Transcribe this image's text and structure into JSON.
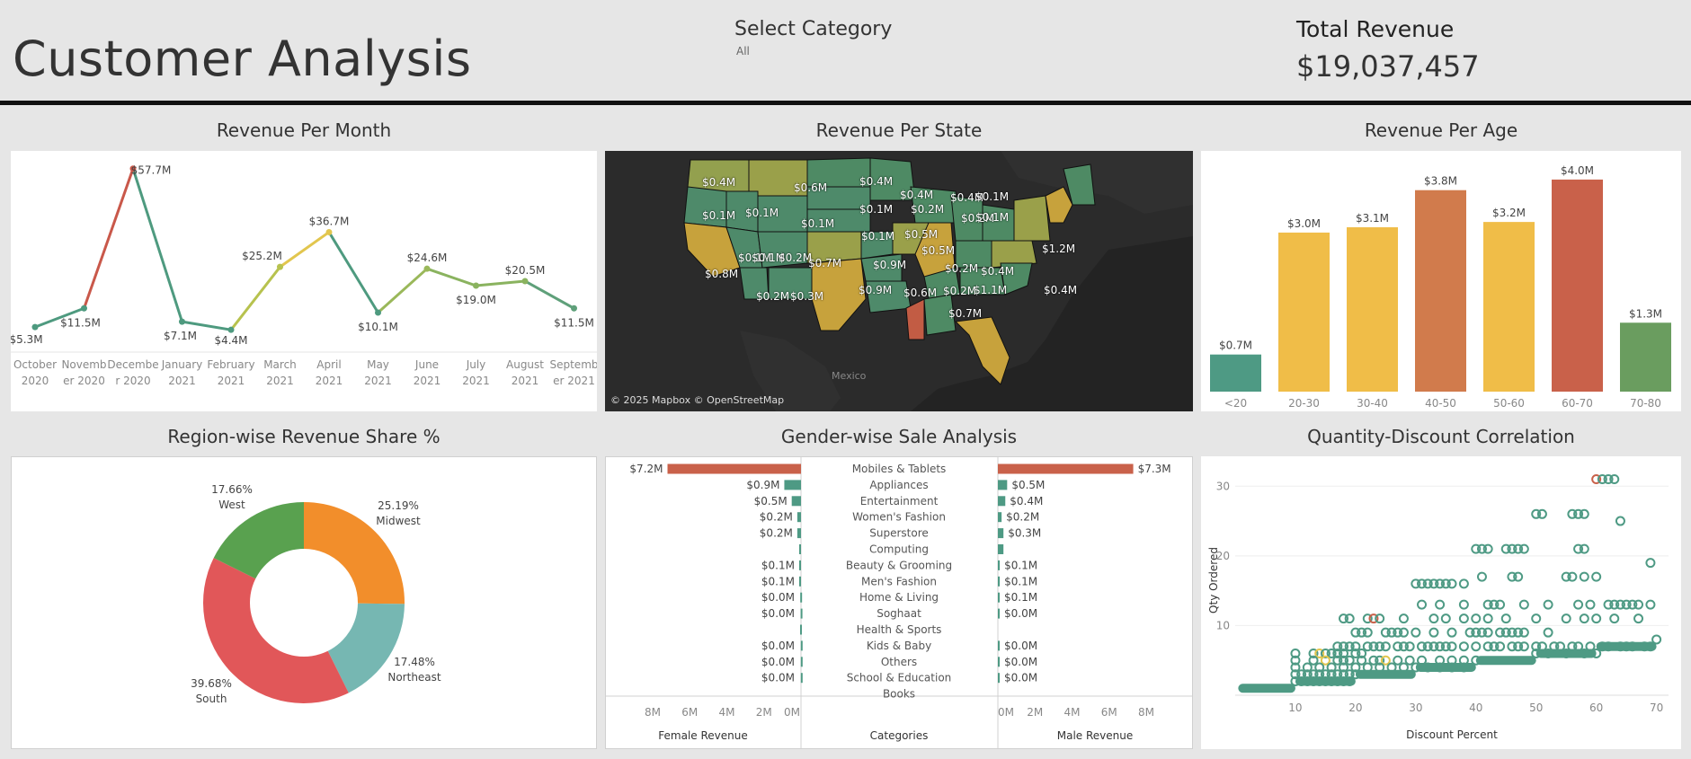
{
  "header": {
    "title": "Customer Analysis",
    "category_label": "Select Category",
    "category_value": "All",
    "revenue_label": "Total Revenue",
    "revenue_value": "$19,037,457"
  },
  "panels": {
    "month": "Revenue Per Month",
    "state": "Revenue Per State",
    "age": "Revenue Per Age",
    "region": "Region-wise Revenue Share %",
    "gender": "Gender-wise Sale Analysis",
    "scatter": "Quantity-Discount Correlation"
  },
  "map": {
    "copyright": "© 2025 Mapbox © OpenStreetMap",
    "country_label": "Mexico"
  },
  "chart_data": [
    {
      "id": "month",
      "type": "line",
      "title": "Revenue Per Month",
      "categories": [
        [
          "October",
          "2020"
        ],
        [
          "Novemb",
          "er 2020"
        ],
        [
          "Decembe",
          "r 2020"
        ],
        [
          "January",
          "2021"
        ],
        [
          "February",
          "2021"
        ],
        [
          "March",
          "2021"
        ],
        [
          "April",
          "2021"
        ],
        [
          "May",
          "2021"
        ],
        [
          "June",
          "2021"
        ],
        [
          "July",
          "2021"
        ],
        [
          "August",
          "2021"
        ],
        [
          "Septemb",
          "er 2021"
        ]
      ],
      "values": [
        5.3,
        11.5,
        57.7,
        7.1,
        4.4,
        25.2,
        36.7,
        10.1,
        24.6,
        19.0,
        20.5,
        11.5
      ],
      "labels": [
        "$5.3M",
        "$11.5M",
        "$57.7M",
        "$7.1M",
        "$4.4M",
        "$25.2M",
        "$36.7M",
        "$10.1M",
        "$24.6M",
        "$19.0M",
        "$20.5M",
        "$11.5M"
      ],
      "colors": [
        "#4e9a7f",
        "#4e9a7f",
        "#c9584a",
        "#4e9a7f",
        "#4e9a7f",
        "#b7c24e",
        "#e2c64e",
        "#4e9a7f",
        "#9ab85a",
        "#8ab35f",
        "#8ab35f",
        "#5fa07a"
      ],
      "ylim": [
        0,
        60
      ]
    },
    {
      "id": "age",
      "type": "bar",
      "title": "Revenue Per Age",
      "categories": [
        "<20",
        "20-30",
        "30-40",
        "40-50",
        "50-60",
        "60-70",
        "70-80"
      ],
      "values": [
        0.7,
        3.0,
        3.1,
        3.8,
        3.2,
        4.0,
        1.3
      ],
      "labels": [
        "$0.7M",
        "$3.0M",
        "$3.1M",
        "$3.8M",
        "$3.2M",
        "$4.0M",
        "$1.3M"
      ],
      "colors": [
        "#4e9a84",
        "#f0bd48",
        "#f0bd48",
        "#d17b4c",
        "#f0bd48",
        "#c9614a",
        "#6a9d5f"
      ],
      "ylim": [
        0,
        4.1
      ]
    },
    {
      "id": "region",
      "type": "pie",
      "title": "Region-wise Revenue Share %",
      "slices": [
        {
          "name": "Midwest",
          "value": 25.19,
          "label": "25.19%",
          "color": "#f28e2b"
        },
        {
          "name": "Northeast",
          "value": 17.48,
          "label": "17.48%",
          "color": "#76b7b2"
        },
        {
          "name": "South",
          "value": 39.68,
          "label": "39.68%",
          "color": "#e15759"
        },
        {
          "name": "West",
          "value": 17.66,
          "label": "17.66%",
          "color": "#59a14f"
        }
      ]
    },
    {
      "id": "gender",
      "type": "bar",
      "title": "Gender-wise Sale Analysis",
      "categories": [
        "Mobiles & Tablets",
        "Appliances",
        "Entertainment",
        "Women's Fashion",
        "Superstore",
        "Computing",
        "Beauty & Grooming",
        "Men's Fashion",
        "Home & Living",
        "Soghaat",
        "Health & Sports",
        "Kids & Baby",
        "Others",
        "School & Education",
        "Books"
      ],
      "series": [
        {
          "name": "Female Revenue",
          "values": [
            7.2,
            0.9,
            0.5,
            0.2,
            0.2,
            0.1,
            0.1,
            0.1,
            0.04,
            0.02,
            0.05,
            0.01,
            0.01,
            0.01,
            0
          ],
          "labels": [
            "$7.2M",
            "$0.9M",
            "$0.5M",
            "$0.2M",
            "$0.2M",
            "",
            "$0.1M",
            "$0.1M",
            "$0.0M",
            "$0.0M",
            "",
            "$0.0M",
            "$0.0M",
            "$0.0M",
            ""
          ]
        },
        {
          "name": "Male Revenue",
          "values": [
            7.3,
            0.5,
            0.4,
            0.2,
            0.3,
            0.3,
            0.1,
            0.1,
            0.05,
            0.02,
            0,
            0.01,
            0.01,
            0.01,
            0
          ],
          "labels": [
            "$7.3M",
            "$0.5M",
            "$0.4M",
            "$0.2M",
            "$0.3M",
            "",
            "$0.1M",
            "$0.1M",
            "$0.1M",
            "$0.0M",
            "",
            "$0.0M",
            "$0.0M",
            "$0.0M",
            ""
          ]
        }
      ],
      "axis_ticks": [
        "8M",
        "6M",
        "4M",
        "2M",
        "0M"
      ],
      "xmax": 8,
      "xlabel_left": "Female Revenue",
      "xlabel_center": "Categories",
      "xlabel_right": "Male Revenue",
      "colors": {
        "top": "#c9614a",
        "other": "#4e9a84"
      }
    },
    {
      "id": "scatter",
      "type": "scatter",
      "title": "Quantity-Discount Correlation",
      "xlabel": "Discount Percent",
      "ylabel": "Qty Ordered",
      "xlim": [
        0,
        72
      ],
      "ylim": [
        0,
        33
      ],
      "xticks": [
        10,
        20,
        30,
        40,
        50,
        60,
        70
      ],
      "yticks": [
        10,
        20,
        30
      ],
      "color": "#4e9a84",
      "highlight_colors": [
        "#c9614a",
        "#e2c64e"
      ],
      "points": [
        [
          60,
          31,
          1
        ],
        [
          61,
          31,
          0
        ],
        [
          62,
          31,
          0
        ],
        [
          63,
          31,
          0
        ],
        [
          50,
          26,
          0
        ],
        [
          51,
          26,
          0
        ],
        [
          56,
          26,
          0
        ],
        [
          57,
          26,
          0
        ],
        [
          58,
          26,
          0
        ],
        [
          64,
          25,
          0
        ],
        [
          40,
          21,
          0
        ],
        [
          41,
          21,
          0
        ],
        [
          42,
          21,
          0
        ],
        [
          45,
          21,
          0
        ],
        [
          46,
          21,
          0
        ],
        [
          47,
          21,
          0
        ],
        [
          48,
          21,
          0
        ],
        [
          57,
          21,
          0
        ],
        [
          58,
          21,
          0
        ],
        [
          69,
          19,
          0
        ],
        [
          30,
          16,
          0
        ],
        [
          31,
          16,
          0
        ],
        [
          32,
          16,
          0
        ],
        [
          33,
          16,
          0
        ],
        [
          34,
          16,
          0
        ],
        [
          35,
          16,
          0
        ],
        [
          36,
          16,
          0
        ],
        [
          38,
          16,
          0
        ],
        [
          41,
          17,
          0
        ],
        [
          46,
          17,
          0
        ],
        [
          47,
          17,
          0
        ],
        [
          55,
          17,
          0
        ],
        [
          56,
          17,
          0
        ],
        [
          58,
          17,
          0
        ],
        [
          60,
          17,
          0
        ],
        [
          31,
          13,
          0
        ],
        [
          34,
          13,
          0
        ],
        [
          38,
          13,
          0
        ],
        [
          42,
          13,
          0
        ],
        [
          43,
          13,
          0
        ],
        [
          44,
          13,
          0
        ],
        [
          48,
          13,
          0
        ],
        [
          52,
          13,
          0
        ],
        [
          57,
          13,
          0
        ],
        [
          59,
          13,
          0
        ],
        [
          62,
          13,
          0
        ],
        [
          63,
          13,
          0
        ],
        [
          64,
          13,
          0
        ],
        [
          65,
          13,
          0
        ],
        [
          66,
          13,
          0
        ],
        [
          67,
          13,
          0
        ],
        [
          69,
          13,
          0
        ],
        [
          18,
          11,
          0
        ],
        [
          19,
          11,
          0
        ],
        [
          22,
          11,
          0
        ],
        [
          23,
          11,
          1
        ],
        [
          24,
          11,
          0
        ],
        [
          28,
          11,
          0
        ],
        [
          33,
          11,
          0
        ],
        [
          35,
          11,
          0
        ],
        [
          38,
          11,
          0
        ],
        [
          40,
          11,
          0
        ],
        [
          42,
          11,
          0
        ],
        [
          45,
          11,
          0
        ],
        [
          50,
          11,
          0
        ],
        [
          55,
          11,
          0
        ],
        [
          58,
          11,
          0
        ],
        [
          60,
          11,
          0
        ],
        [
          63,
          11,
          0
        ],
        [
          67,
          11,
          0
        ],
        [
          20,
          9,
          0
        ],
        [
          21,
          9,
          0
        ],
        [
          22,
          9,
          0
        ],
        [
          25,
          9,
          0
        ],
        [
          26,
          9,
          0
        ],
        [
          27,
          9,
          0
        ],
        [
          28,
          9,
          0
        ],
        [
          30,
          9,
          0
        ],
        [
          33,
          9,
          0
        ],
        [
          36,
          9,
          0
        ],
        [
          39,
          9,
          0
        ],
        [
          40,
          9,
          0
        ],
        [
          41,
          9,
          0
        ],
        [
          42,
          9,
          0
        ],
        [
          44,
          9,
          0
        ],
        [
          45,
          9,
          0
        ],
        [
          46,
          9,
          0
        ],
        [
          47,
          9,
          0
        ],
        [
          48,
          9,
          0
        ],
        [
          52,
          9,
          0
        ],
        [
          17,
          7,
          0
        ],
        [
          18,
          7,
          0
        ],
        [
          19,
          7,
          0
        ],
        [
          20,
          7,
          0
        ],
        [
          22,
          7,
          0
        ],
        [
          23,
          7,
          0
        ],
        [
          24,
          7,
          0
        ],
        [
          25,
          7,
          0
        ],
        [
          27,
          7,
          0
        ],
        [
          28,
          7,
          0
        ],
        [
          29,
          7,
          0
        ],
        [
          31,
          7,
          0
        ],
        [
          32,
          7,
          0
        ],
        [
          33,
          7,
          0
        ],
        [
          34,
          7,
          0
        ],
        [
          35,
          7,
          0
        ],
        [
          36,
          7,
          0
        ],
        [
          38,
          7,
          0
        ],
        [
          40,
          7,
          0
        ],
        [
          42,
          7,
          0
        ],
        [
          43,
          7,
          0
        ],
        [
          44,
          7,
          0
        ],
        [
          46,
          7,
          0
        ],
        [
          47,
          7,
          0
        ],
        [
          48,
          7,
          0
        ],
        [
          50,
          7,
          0
        ],
        [
          51,
          7,
          0
        ],
        [
          53,
          7,
          0
        ],
        [
          54,
          7,
          0
        ],
        [
          56,
          7,
          0
        ],
        [
          57,
          7,
          0
        ],
        [
          59,
          7,
          0
        ],
        [
          61,
          7,
          0
        ],
        [
          62,
          7,
          0
        ],
        [
          64,
          7,
          0
        ],
        [
          65,
          7,
          0
        ],
        [
          66,
          7,
          0
        ],
        [
          68,
          7,
          0
        ],
        [
          69,
          7,
          0
        ],
        [
          10,
          6,
          0
        ],
        [
          13,
          6,
          0
        ],
        [
          14,
          6,
          2
        ],
        [
          15,
          6,
          0
        ],
        [
          16,
          6,
          0
        ],
        [
          17,
          6,
          0
        ],
        [
          18,
          6,
          0
        ],
        [
          20,
          6,
          0
        ],
        [
          21,
          6,
          0
        ],
        [
          50,
          6,
          0
        ],
        [
          52,
          6,
          0
        ],
        [
          55,
          6,
          0
        ],
        [
          58,
          6,
          0
        ],
        [
          60,
          6,
          0
        ],
        [
          70,
          8,
          0
        ],
        [
          10,
          5,
          0
        ],
        [
          13,
          5,
          0
        ],
        [
          15,
          5,
          2
        ],
        [
          17,
          5,
          0
        ],
        [
          18,
          5,
          0
        ],
        [
          19,
          5,
          0
        ],
        [
          21,
          5,
          0
        ],
        [
          23,
          5,
          0
        ],
        [
          24,
          5,
          0
        ],
        [
          25,
          5,
          2
        ],
        [
          27,
          5,
          0
        ],
        [
          29,
          5,
          0
        ],
        [
          31,
          5,
          0
        ],
        [
          34,
          5,
          0
        ],
        [
          36,
          5,
          0
        ],
        [
          38,
          5,
          0
        ],
        [
          40,
          5,
          0
        ],
        [
          10,
          4,
          0
        ],
        [
          12,
          4,
          0
        ],
        [
          14,
          4,
          0
        ],
        [
          16,
          4,
          0
        ],
        [
          18,
          4,
          0
        ],
        [
          20,
          4,
          0
        ],
        [
          22,
          4,
          0
        ],
        [
          24,
          4,
          0
        ],
        [
          26,
          4,
          0
        ],
        [
          28,
          4,
          0
        ],
        [
          30,
          4,
          0
        ],
        [
          32,
          4,
          0
        ],
        [
          34,
          4,
          0
        ],
        [
          36,
          4,
          0
        ],
        [
          38,
          4,
          0
        ],
        [
          10,
          3,
          0
        ],
        [
          11,
          3,
          0
        ],
        [
          12,
          3,
          0
        ],
        [
          13,
          3,
          0
        ],
        [
          14,
          3,
          0
        ],
        [
          15,
          3,
          0
        ],
        [
          16,
          3,
          0
        ],
        [
          17,
          3,
          0
        ],
        [
          18,
          3,
          0
        ],
        [
          19,
          3,
          0
        ],
        [
          20,
          3,
          0
        ],
        [
          10,
          2,
          0
        ],
        [
          11,
          2,
          0
        ],
        [
          12,
          2,
          0
        ],
        [
          13,
          2,
          0
        ],
        [
          14,
          2,
          0
        ],
        [
          15,
          2,
          0
        ],
        [
          16,
          2,
          0
        ],
        [
          17,
          2,
          0
        ],
        [
          18,
          2,
          0
        ],
        [
          19,
          2,
          0
        ]
      ],
      "bands": [
        {
          "x0": 0.5,
          "x1": 10,
          "y": 1
        },
        {
          "x0": 10,
          "x1": 20,
          "y": 2
        },
        {
          "x0": 20,
          "x1": 30,
          "y": 3
        },
        {
          "x0": 30,
          "x1": 40,
          "y": 4
        },
        {
          "x0": 40,
          "x1": 50,
          "y": 5
        },
        {
          "x0": 50,
          "x1": 60,
          "y": 6
        },
        {
          "x0": 60,
          "x1": 70,
          "y": 7
        }
      ]
    },
    {
      "id": "state",
      "type": "map",
      "title": "Revenue Per State",
      "labels": [
        "$0.4M",
        "$0.6M",
        "$0.4M",
        "$0.4M",
        "$0.1M",
        "$0.1M",
        "$0.1M",
        "$0.2M",
        "$0.1M",
        "$0.4M",
        "$0.1M",
        "$0.5M",
        "$0.2M",
        "$0.1M",
        "$0.1M",
        "$0.7M",
        "$0.1M",
        "$0.9M",
        "$0.5M",
        "$1.2M",
        "$0.8M",
        "$0.1M",
        "$0.2M",
        "$0.2M",
        "$0.3M",
        "$0.9M",
        "$0.6M",
        "$0.2M",
        "$0.4M",
        "$1.1M",
        "$0.4M",
        "$0.2M",
        "$0.7M"
      ]
    }
  ]
}
